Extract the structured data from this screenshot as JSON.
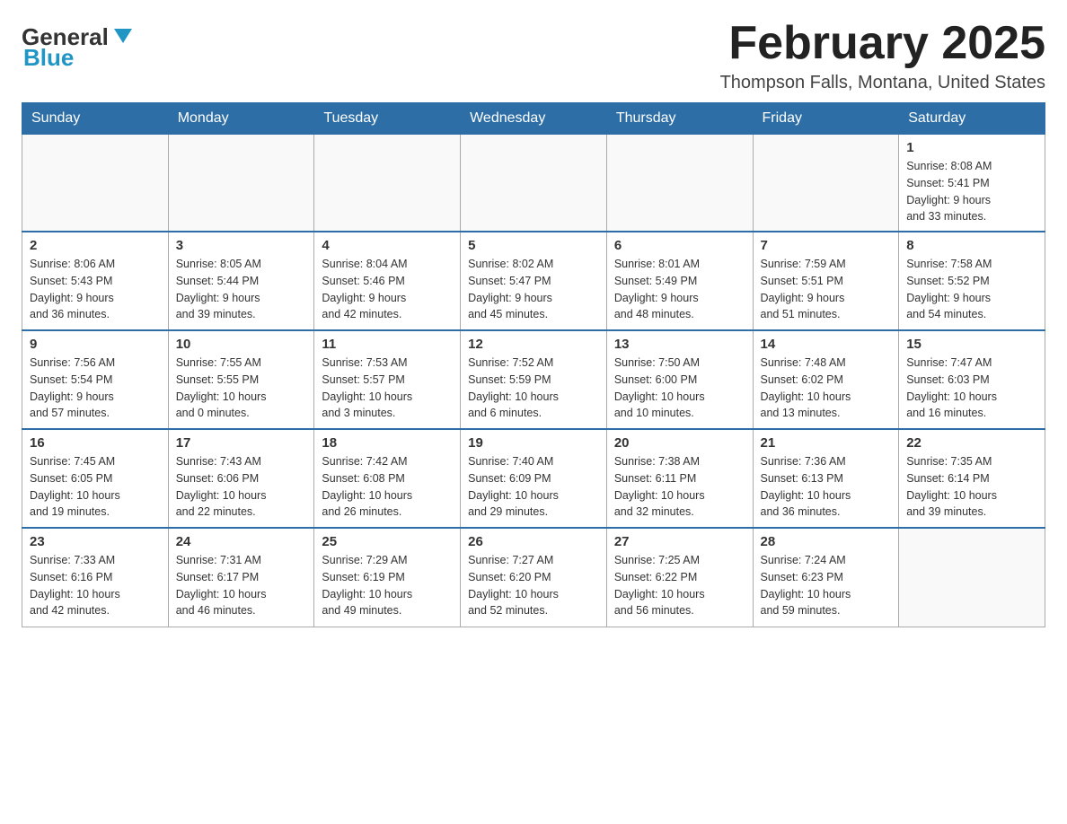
{
  "header": {
    "logo_general": "General",
    "logo_blue": "Blue",
    "month_title": "February 2025",
    "location": "Thompson Falls, Montana, United States"
  },
  "days_of_week": [
    "Sunday",
    "Monday",
    "Tuesday",
    "Wednesday",
    "Thursday",
    "Friday",
    "Saturday"
  ],
  "weeks": [
    {
      "days": [
        {
          "number": "",
          "info": ""
        },
        {
          "number": "",
          "info": ""
        },
        {
          "number": "",
          "info": ""
        },
        {
          "number": "",
          "info": ""
        },
        {
          "number": "",
          "info": ""
        },
        {
          "number": "",
          "info": ""
        },
        {
          "number": "1",
          "info": "Sunrise: 8:08 AM\nSunset: 5:41 PM\nDaylight: 9 hours\nand 33 minutes."
        }
      ]
    },
    {
      "days": [
        {
          "number": "2",
          "info": "Sunrise: 8:06 AM\nSunset: 5:43 PM\nDaylight: 9 hours\nand 36 minutes."
        },
        {
          "number": "3",
          "info": "Sunrise: 8:05 AM\nSunset: 5:44 PM\nDaylight: 9 hours\nand 39 minutes."
        },
        {
          "number": "4",
          "info": "Sunrise: 8:04 AM\nSunset: 5:46 PM\nDaylight: 9 hours\nand 42 minutes."
        },
        {
          "number": "5",
          "info": "Sunrise: 8:02 AM\nSunset: 5:47 PM\nDaylight: 9 hours\nand 45 minutes."
        },
        {
          "number": "6",
          "info": "Sunrise: 8:01 AM\nSunset: 5:49 PM\nDaylight: 9 hours\nand 48 minutes."
        },
        {
          "number": "7",
          "info": "Sunrise: 7:59 AM\nSunset: 5:51 PM\nDaylight: 9 hours\nand 51 minutes."
        },
        {
          "number": "8",
          "info": "Sunrise: 7:58 AM\nSunset: 5:52 PM\nDaylight: 9 hours\nand 54 minutes."
        }
      ]
    },
    {
      "days": [
        {
          "number": "9",
          "info": "Sunrise: 7:56 AM\nSunset: 5:54 PM\nDaylight: 9 hours\nand 57 minutes."
        },
        {
          "number": "10",
          "info": "Sunrise: 7:55 AM\nSunset: 5:55 PM\nDaylight: 10 hours\nand 0 minutes."
        },
        {
          "number": "11",
          "info": "Sunrise: 7:53 AM\nSunset: 5:57 PM\nDaylight: 10 hours\nand 3 minutes."
        },
        {
          "number": "12",
          "info": "Sunrise: 7:52 AM\nSunset: 5:59 PM\nDaylight: 10 hours\nand 6 minutes."
        },
        {
          "number": "13",
          "info": "Sunrise: 7:50 AM\nSunset: 6:00 PM\nDaylight: 10 hours\nand 10 minutes."
        },
        {
          "number": "14",
          "info": "Sunrise: 7:48 AM\nSunset: 6:02 PM\nDaylight: 10 hours\nand 13 minutes."
        },
        {
          "number": "15",
          "info": "Sunrise: 7:47 AM\nSunset: 6:03 PM\nDaylight: 10 hours\nand 16 minutes."
        }
      ]
    },
    {
      "days": [
        {
          "number": "16",
          "info": "Sunrise: 7:45 AM\nSunset: 6:05 PM\nDaylight: 10 hours\nand 19 minutes."
        },
        {
          "number": "17",
          "info": "Sunrise: 7:43 AM\nSunset: 6:06 PM\nDaylight: 10 hours\nand 22 minutes."
        },
        {
          "number": "18",
          "info": "Sunrise: 7:42 AM\nSunset: 6:08 PM\nDaylight: 10 hours\nand 26 minutes."
        },
        {
          "number": "19",
          "info": "Sunrise: 7:40 AM\nSunset: 6:09 PM\nDaylight: 10 hours\nand 29 minutes."
        },
        {
          "number": "20",
          "info": "Sunrise: 7:38 AM\nSunset: 6:11 PM\nDaylight: 10 hours\nand 32 minutes."
        },
        {
          "number": "21",
          "info": "Sunrise: 7:36 AM\nSunset: 6:13 PM\nDaylight: 10 hours\nand 36 minutes."
        },
        {
          "number": "22",
          "info": "Sunrise: 7:35 AM\nSunset: 6:14 PM\nDaylight: 10 hours\nand 39 minutes."
        }
      ]
    },
    {
      "days": [
        {
          "number": "23",
          "info": "Sunrise: 7:33 AM\nSunset: 6:16 PM\nDaylight: 10 hours\nand 42 minutes."
        },
        {
          "number": "24",
          "info": "Sunrise: 7:31 AM\nSunset: 6:17 PM\nDaylight: 10 hours\nand 46 minutes."
        },
        {
          "number": "25",
          "info": "Sunrise: 7:29 AM\nSunset: 6:19 PM\nDaylight: 10 hours\nand 49 minutes."
        },
        {
          "number": "26",
          "info": "Sunrise: 7:27 AM\nSunset: 6:20 PM\nDaylight: 10 hours\nand 52 minutes."
        },
        {
          "number": "27",
          "info": "Sunrise: 7:25 AM\nSunset: 6:22 PM\nDaylight: 10 hours\nand 56 minutes."
        },
        {
          "number": "28",
          "info": "Sunrise: 7:24 AM\nSunset: 6:23 PM\nDaylight: 10 hours\nand 59 minutes."
        },
        {
          "number": "",
          "info": ""
        }
      ]
    }
  ]
}
